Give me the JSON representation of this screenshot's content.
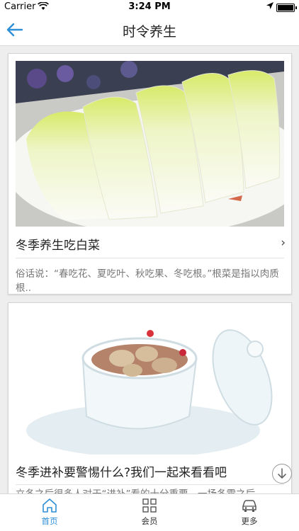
{
  "status_bar": {
    "carrier": "Carrier",
    "time": "3:24 PM"
  },
  "nav": {
    "title": "时令养生",
    "back_icon": "back-arrow-icon"
  },
  "articles": [
    {
      "title": "冬季养生吃白菜",
      "excerpt": "俗话说：“春吃花、夏吃叶、秋吃果、冬吃根。”根菜是指以肉质根..",
      "image": "napa-cabbage-photo"
    },
    {
      "title": "冬季进补要警惕什么?我们一起来看看吧",
      "excerpt": "立冬之后很多人对于“进补”看的十分重要，一场冬雪之后",
      "image": "stewed-soup-pot-photo"
    }
  ],
  "tabs": [
    {
      "label": "首页",
      "icon": "home-icon",
      "active": true
    },
    {
      "label": "会员",
      "icon": "member-grid-icon",
      "active": false
    },
    {
      "label": "更多",
      "icon": "car-icon",
      "active": false
    }
  ],
  "colors": {
    "accent": "#2d8fd6",
    "background": "#eeeeee"
  }
}
